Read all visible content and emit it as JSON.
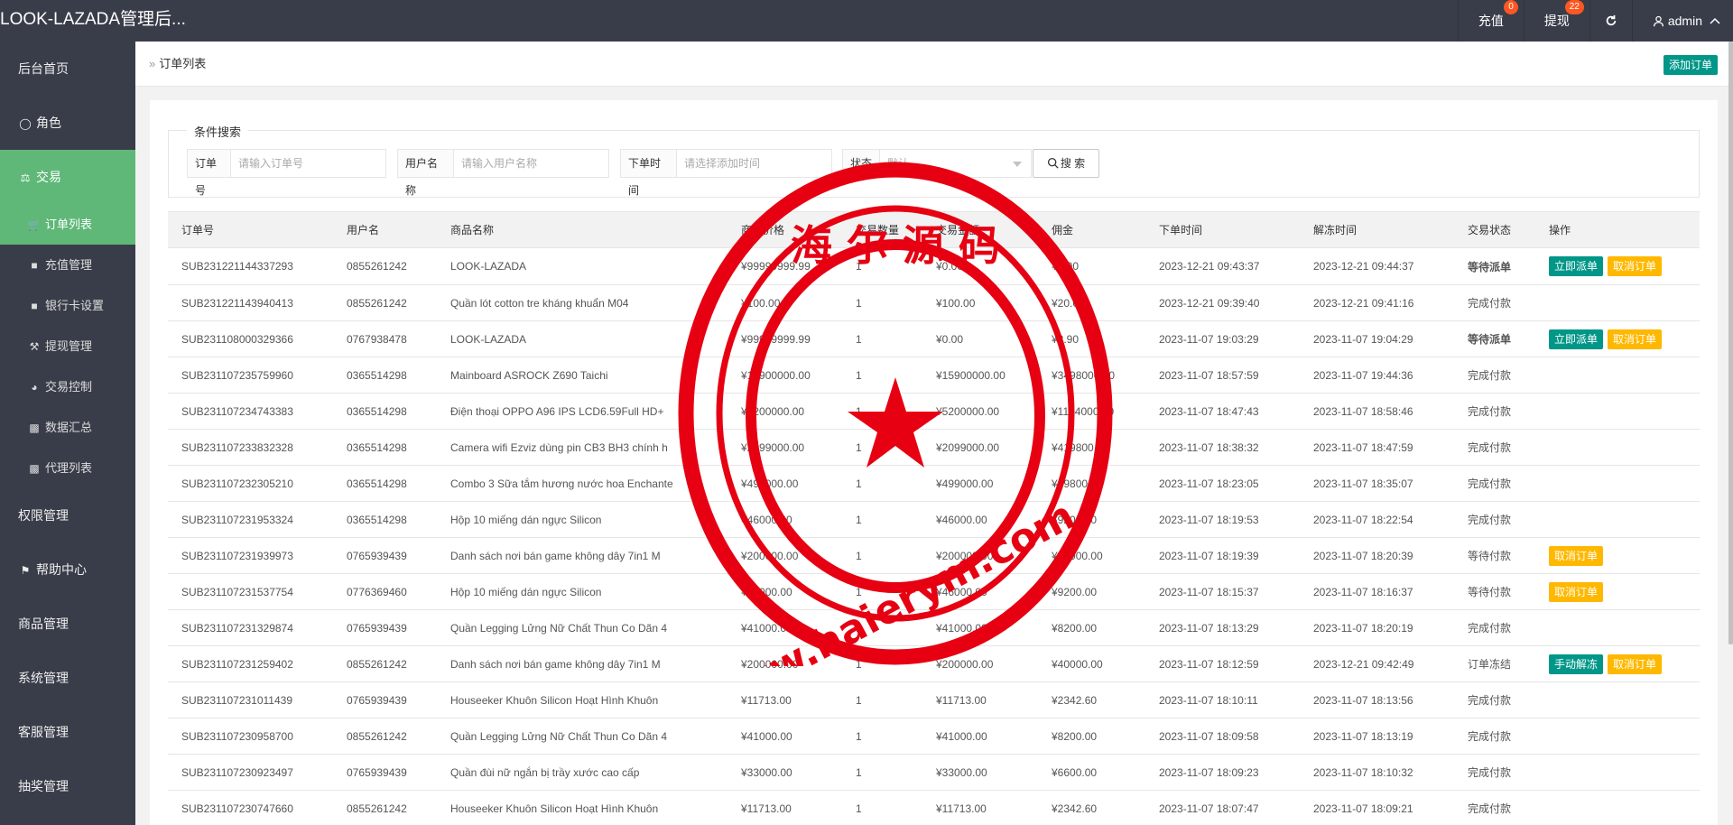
{
  "header": {
    "logo": "LOOK-LAZADA管理后...",
    "recharge_label": "充值",
    "recharge_badge": "0",
    "withdraw_label": "提现",
    "withdraw_badge": "22",
    "refresh_icon": "refresh-icon",
    "user_label": "admin"
  },
  "sidebar": {
    "items": [
      {
        "label": "后台首页",
        "icon": ""
      },
      {
        "label": "角色",
        "icon": "user-icon"
      },
      {
        "label": "交易",
        "icon": "scale-icon"
      },
      {
        "label": "订单列表",
        "icon": "cart-icon"
      },
      {
        "label": "充值管理",
        "icon": "comment-icon"
      },
      {
        "label": "银行卡设置",
        "icon": "comment-icon"
      },
      {
        "label": "提现管理",
        "icon": "hammer-icon"
      },
      {
        "label": "交易控制",
        "icon": "gauge-icon"
      },
      {
        "label": "数据汇总",
        "icon": "chart-icon"
      },
      {
        "label": "代理列表",
        "icon": "chart-icon"
      },
      {
        "label": "权限管理",
        "icon": ""
      },
      {
        "label": "帮助中心",
        "icon": "flag-icon"
      },
      {
        "label": "商品管理",
        "icon": ""
      },
      {
        "label": "系统管理",
        "icon": ""
      },
      {
        "label": "客服管理",
        "icon": ""
      },
      {
        "label": "抽奖管理",
        "icon": ""
      }
    ]
  },
  "topbar": {
    "breadcrumb": "订单列表",
    "add_button": "添加订单"
  },
  "search": {
    "legend": "条件搜索",
    "order_label": "订单号",
    "order_placeholder": "请输入订单号",
    "user_label": "用户名称",
    "user_placeholder": "请输入用户名称",
    "time_label": "下单时间",
    "time_placeholder": "请选择添加时间",
    "status_label": "状态",
    "status_value": "默认",
    "button": "搜 索"
  },
  "table": {
    "headers": [
      "订单号",
      "用户名",
      "商品名称",
      "商品价格",
      "交易数量",
      "交易金额",
      "佣金",
      "下单时间",
      "解冻时间",
      "交易状态",
      "操作"
    ],
    "rows": [
      {
        "order": "SUB231221144337293",
        "user": "0855261242",
        "product": "LOOK-LAZADA",
        "price": "¥99999999.99",
        "qty": "1",
        "amount": "¥0.00",
        "commission": "¥2.90",
        "created": "2023-12-21 09:43:37",
        "unfrozen": "2023-12-21 09:44:37",
        "status": "等待派单",
        "status_red": true,
        "actions": [
          "立即派单",
          "取消订单"
        ]
      },
      {
        "order": "SUB231221143940413",
        "user": "0855261242",
        "product": "Quần lót cotton tre kháng khuẩn M04",
        "price": "¥100.00",
        "qty": "1",
        "amount": "¥100.00",
        "commission": "¥20.00",
        "created": "2023-12-21 09:39:40",
        "unfrozen": "2023-12-21 09:41:16",
        "status": "完成付款",
        "status_red": false,
        "actions": []
      },
      {
        "order": "SUB231108000329366",
        "user": "0767938478",
        "product": "LOOK-LAZADA",
        "price": "¥99999999.99",
        "qty": "1",
        "amount": "¥0.00",
        "commission": "¥2.90",
        "created": "2023-11-07 19:03:29",
        "unfrozen": "2023-11-07 19:04:29",
        "status": "等待派单",
        "status_red": true,
        "actions": [
          "立即派单",
          "取消订单"
        ]
      },
      {
        "order": "SUB231107235759960",
        "user": "0365514298",
        "product": "Mainboard ASROCK Z690 Taichi",
        "price": "¥15900000.00",
        "qty": "1",
        "amount": "¥15900000.00",
        "commission": "¥3498000.00",
        "created": "2023-11-07 18:57:59",
        "unfrozen": "2023-11-07 19:44:36",
        "status": "完成付款",
        "status_red": false,
        "actions": []
      },
      {
        "order": "SUB231107234743383",
        "user": "0365514298",
        "product": "Điện thoại OPPO A96 IPS LCD6.59Full HD+",
        "price": "¥5200000.00",
        "qty": "1",
        "amount": "¥5200000.00",
        "commission": "¥1144000.00",
        "created": "2023-11-07 18:47:43",
        "unfrozen": "2023-11-07 18:58:46",
        "status": "完成付款",
        "status_red": false,
        "actions": []
      },
      {
        "order": "SUB231107233832328",
        "user": "0365514298",
        "product": "Camera wifi Ezviz dùng pin CB3 BH3 chính h",
        "price": "¥2099000.00",
        "qty": "1",
        "amount": "¥2099000.00",
        "commission": "¥419800.00",
        "created": "2023-11-07 18:38:32",
        "unfrozen": "2023-11-07 18:47:59",
        "status": "完成付款",
        "status_red": false,
        "actions": []
      },
      {
        "order": "SUB231107232305210",
        "user": "0365514298",
        "product": "Combo 3 Sữa tắm hương nước hoa Enchante",
        "price": "¥499000.00",
        "qty": "1",
        "amount": "¥499000.00",
        "commission": "¥99800.00",
        "created": "2023-11-07 18:23:05",
        "unfrozen": "2023-11-07 18:35:07",
        "status": "完成付款",
        "status_red": false,
        "actions": []
      },
      {
        "order": "SUB231107231953324",
        "user": "0365514298",
        "product": "Hộp 10 miếng dán ngực Silicon",
        "price": "¥46000.00",
        "qty": "1",
        "amount": "¥46000.00",
        "commission": "¥9200.00",
        "created": "2023-11-07 18:19:53",
        "unfrozen": "2023-11-07 18:22:54",
        "status": "完成付款",
        "status_red": false,
        "actions": []
      },
      {
        "order": "SUB231107231939973",
        "user": "0765939439",
        "product": "Danh sách nơi bán game không dây 7in1 M",
        "price": "¥200000.00",
        "qty": "1",
        "amount": "¥200000.00",
        "commission": "¥40000.00",
        "created": "2023-11-07 18:19:39",
        "unfrozen": "2023-11-07 18:20:39",
        "status": "等待付款",
        "status_red": false,
        "actions": [
          "取消订单"
        ]
      },
      {
        "order": "SUB231107231537754",
        "user": "0776369460",
        "product": "Hộp 10 miếng dán ngực Silicon",
        "price": "¥46000.00",
        "qty": "1",
        "amount": "¥46000.00",
        "commission": "¥9200.00",
        "created": "2023-11-07 18:15:37",
        "unfrozen": "2023-11-07 18:16:37",
        "status": "等待付款",
        "status_red": false,
        "actions": [
          "取消订单"
        ]
      },
      {
        "order": "SUB231107231329874",
        "user": "0765939439",
        "product": "Quần Legging Lửng Nữ Chất Thun Co Dãn 4",
        "price": "¥41000.00",
        "qty": "1",
        "amount": "¥41000.00",
        "commission": "¥8200.00",
        "created": "2023-11-07 18:13:29",
        "unfrozen": "2023-11-07 18:20:19",
        "status": "完成付款",
        "status_red": false,
        "actions": []
      },
      {
        "order": "SUB231107231259402",
        "user": "0855261242",
        "product": "Danh sách nơi bán game không dây 7in1 M",
        "price": "¥200000.00",
        "qty": "1",
        "amount": "¥200000.00",
        "commission": "¥40000.00",
        "created": "2023-11-07 18:12:59",
        "unfrozen": "2023-12-21 09:42:49",
        "status": "订单冻结",
        "status_red": false,
        "actions": [
          "手动解冻",
          "取消订单"
        ]
      },
      {
        "order": "SUB231107231011439",
        "user": "0765939439",
        "product": "Houseeker Khuôn Silicon Hoạt Hình Khuôn",
        "price": "¥11713.00",
        "qty": "1",
        "amount": "¥11713.00",
        "commission": "¥2342.60",
        "created": "2023-11-07 18:10:11",
        "unfrozen": "2023-11-07 18:13:56",
        "status": "完成付款",
        "status_red": false,
        "actions": []
      },
      {
        "order": "SUB231107230958700",
        "user": "0855261242",
        "product": "Quần Legging Lửng Nữ Chất Thun Co Dãn 4",
        "price": "¥41000.00",
        "qty": "1",
        "amount": "¥41000.00",
        "commission": "¥8200.00",
        "created": "2023-11-07 18:09:58",
        "unfrozen": "2023-11-07 18:13:19",
        "status": "完成付款",
        "status_red": false,
        "actions": []
      },
      {
        "order": "SUB231107230923497",
        "user": "0765939439",
        "product": "Quần đùi nữ ngắn bị trầy xước cao cấp",
        "price": "¥33000.00",
        "qty": "1",
        "amount": "¥33000.00",
        "commission": "¥6600.00",
        "created": "2023-11-07 18:09:23",
        "unfrozen": "2023-11-07 18:10:32",
        "status": "完成付款",
        "status_red": false,
        "actions": []
      },
      {
        "order": "SUB231107230747660",
        "user": "0855261242",
        "product": "Houseeker Khuôn Silicon Hoạt Hình Khuôn",
        "price": "¥11713.00",
        "qty": "1",
        "amount": "¥11713.00",
        "commission": "¥2342.60",
        "created": "2023-11-07 18:07:47",
        "unfrozen": "2023-11-07 18:09:21",
        "status": "完成付款",
        "status_red": false,
        "actions": []
      }
    ]
  },
  "watermark": {
    "top_text": "海 尔 源 码",
    "bottom_text": "www.haierym.com",
    "color": "#e60012"
  },
  "colors": {
    "header_bg": "#393d49",
    "sidebar_active": "#5fb878",
    "teal": "#009688",
    "orange": "#ffb800",
    "badge": "#ff5722"
  }
}
